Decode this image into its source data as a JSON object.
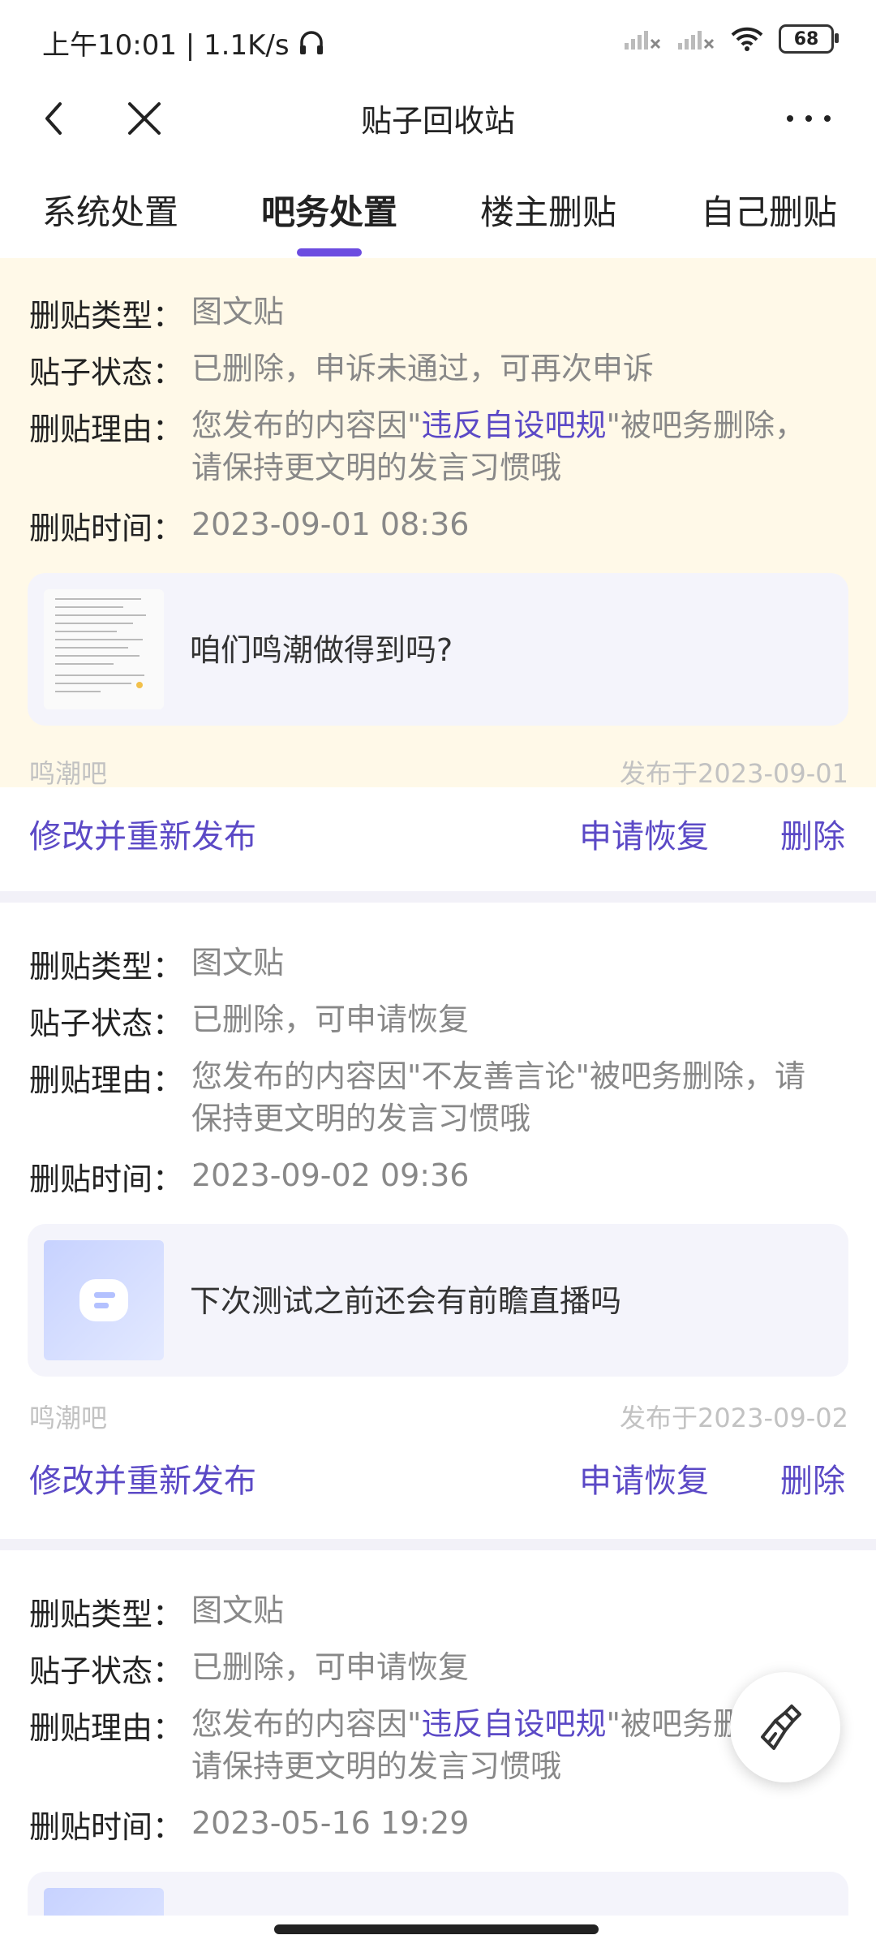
{
  "status": {
    "time_speed": "上午10:01 | 1.1K/s",
    "battery": "68"
  },
  "header": {
    "title": "贴子回收站"
  },
  "tabs": [
    {
      "label": "系统处置"
    },
    {
      "label": "吧务处置"
    },
    {
      "label": "楼主删贴"
    },
    {
      "label": "自己删贴"
    }
  ],
  "labels": {
    "type": "删贴类型：",
    "status": "贴子状态：",
    "reason": "删贴理由：",
    "time": "删贴时间："
  },
  "cards": [
    {
      "type": "图文贴",
      "status": "已删除，申诉未通过，可再次申诉",
      "reason_prefix": "您发布的内容因\"",
      "reason_highlight": "违反自设吧规",
      "reason_suffix": "\"被吧务删除，",
      "reason_line2": "请保持更文明的发言习惯哦",
      "time": "2023-09-01 08:36",
      "post_title": "咱们鸣潮做得到吗?",
      "bar": "鸣潮吧",
      "published": "发布于2023-09-01",
      "action_edit": "修改并重新发布",
      "action_restore": "申请恢复",
      "action_delete": "删除"
    },
    {
      "type": "图文贴",
      "status": "已删除，可申请恢复",
      "reason_line1": "您发布的内容因\"不友善言论\"被吧务删除，请",
      "reason_line2": "保持更文明的发言习惯哦",
      "time": "2023-09-02 09:36",
      "post_title": "下次测试之前还会有前瞻直播吗",
      "bar": "鸣潮吧",
      "published": "发布于2023-09-02",
      "action_edit": "修改并重新发布",
      "action_restore": "申请恢复",
      "action_delete": "删除"
    },
    {
      "type": "图文贴",
      "status": "已删除，可申请恢复",
      "reason_prefix": "您发布的内容因\"",
      "reason_highlight": "违反自设吧规",
      "reason_suffix": "\"被吧务删",
      "reason_line2": "请保持更文明的发言习惯哦",
      "time": "2023-05-16 19:29"
    }
  ],
  "colors": {
    "accent": "#5b49c6",
    "highlight_bg": "#fff9e8",
    "divider": "#f2f1f8"
  }
}
